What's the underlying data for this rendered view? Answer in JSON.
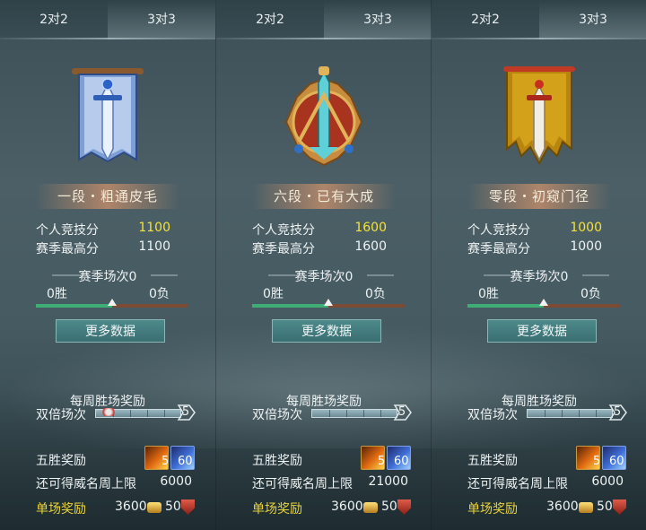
{
  "tabs": [
    "2对2",
    "3对3"
  ],
  "labels": {
    "personal_score": "个人竞技分",
    "season_high": "赛季最高分",
    "season_matches": "赛季场次0",
    "win_suffix": "胜",
    "loss_suffix": "负",
    "more_data": "更多数据",
    "weekly_reward": "每周胜场奖励",
    "double_matches": "双倍场次",
    "five_win_reward": "五胜奖励",
    "weekly_cap": "还可得威名周上限",
    "single_reward": "单场奖励"
  },
  "colors": {
    "score_highlight": "#f5e23a",
    "single_reward_label": "#e8d33a",
    "win_bar": "#3fae76",
    "loss_bar": "#7c4b35"
  },
  "panels": [
    {
      "active_tab": 1,
      "emblem": "blue-sword-banner-icon",
      "rank_name": "一段・粗通皮毛",
      "personal_score": "1100",
      "season_high": "1100",
      "wins": "0胜",
      "losses": "0负",
      "win_ratio": 0.5,
      "double_count": "5",
      "double_progress": 0.08,
      "five_win_items": [
        {
          "icon": "fire-scroll-icon",
          "count": "5"
        },
        {
          "icon": "frost-sword-icon",
          "count": "60"
        }
      ],
      "weekly_cap": "6000",
      "single_reward_coins": "3600",
      "single_reward_shields": "50"
    },
    {
      "active_tab": 1,
      "emblem": "ornate-red-sword-crest-icon",
      "rank_name": "六段・已有大成",
      "personal_score": "1600",
      "season_high": "1600",
      "wins": "0胜",
      "losses": "0负",
      "win_ratio": 0.5,
      "double_count": "5",
      "double_progress": 0,
      "five_win_items": [
        {
          "icon": "fire-scroll-icon",
          "count": "5"
        },
        {
          "icon": "frost-sword-icon",
          "count": "60"
        }
      ],
      "weekly_cap": "21000",
      "single_reward_coins": "3600",
      "single_reward_shields": "50"
    },
    {
      "active_tab": 1,
      "emblem": "gold-sword-banner-icon",
      "rank_name": "零段・初窥门径",
      "personal_score": "1000",
      "season_high": "1000",
      "wins": "0胜",
      "losses": "0负",
      "win_ratio": 0.5,
      "double_count": "5",
      "double_progress": 0,
      "five_win_items": [
        {
          "icon": "fire-scroll-icon",
          "count": "5"
        },
        {
          "icon": "frost-sword-icon",
          "count": "60"
        }
      ],
      "weekly_cap": "6000",
      "single_reward_coins": "3600",
      "single_reward_shields": "50"
    }
  ]
}
